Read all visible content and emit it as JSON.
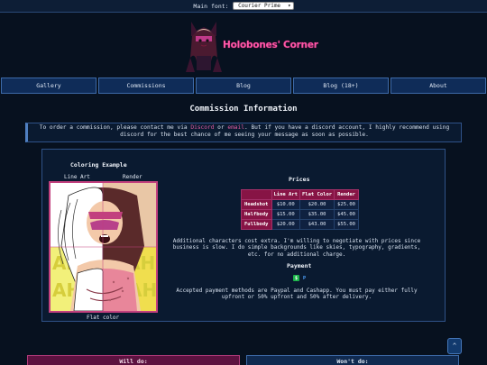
{
  "topbar": {
    "font_label": "Main font:",
    "font_value": "Courier Prime"
  },
  "site": {
    "title": "Holobones' Corner"
  },
  "nav": {
    "items": [
      "Gallery",
      "Commissions",
      "Blog",
      "Blog (18+)",
      "About"
    ]
  },
  "page": {
    "heading": "Commission Information"
  },
  "notice": {
    "text1": "To order a commission, please contact me via ",
    "discord": "Discord",
    "text2": " or ",
    "email": "email",
    "text3": ". But if you have a discord account, I highly recommend using discord for the best chance of me seeing your message as soon as possible."
  },
  "coloring": {
    "title": "Coloring Example",
    "line_art": "Line Art",
    "render": "Render",
    "flat": "Flat color"
  },
  "prices": {
    "title": "Prices",
    "columns": [
      "",
      "Line Art",
      "Flat Color",
      "Render"
    ],
    "rows": [
      {
        "name": "Headshot",
        "values": [
          "$10.00",
          "$20.00",
          "$25.00"
        ]
      },
      {
        "name": "Halfbody",
        "values": [
          "$15.00",
          "$35.00",
          "$45.00"
        ]
      },
      {
        "name": "Fullbody",
        "values": [
          "$20.00",
          "$43.00",
          "$55.00"
        ]
      }
    ],
    "extra_note": "Additional characters cost extra. I'm willing to negotiate with prices since business is slow. I do simple backgrounds like skies, typography, gradients, etc. for no additional charge."
  },
  "payment": {
    "title": "Payment",
    "icons": [
      "cashapp-icon",
      "paypal-icon"
    ],
    "text": "Accepted payment methods are Paypal and Cashapp. You must pay either fully upfront or 50% upfront and 50% after delivery."
  },
  "scroll_top": {
    "label": "^"
  },
  "bottom": {
    "will": "Will do:",
    "wont": "Won't do:"
  },
  "colors": {
    "accent_pink": "#ff58a8",
    "nav_bg": "#0f2c58",
    "page_bg": "#07111f",
    "table_header": "#871445"
  }
}
